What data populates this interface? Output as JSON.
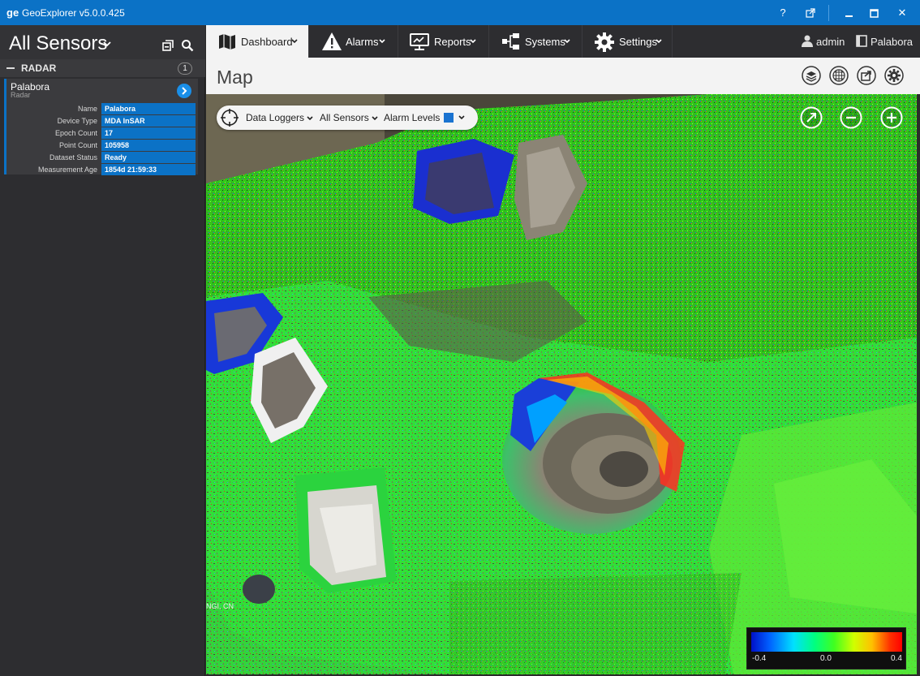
{
  "titlebar": {
    "logo": "ge",
    "title": "GeoExplorer v5.0.0.425",
    "help": "?",
    "popout_icon": "popout-icon",
    "minimize_icon": "minimize-icon",
    "maximize_icon": "maximize-icon",
    "close": "✕"
  },
  "sidebar": {
    "title": "All Sensors",
    "group": {
      "label": "RADAR",
      "count": "1"
    },
    "sensor": {
      "name": "Palabora",
      "type": "Radar",
      "details": [
        {
          "key": "Name",
          "value": "Palabora"
        },
        {
          "key": "Device Type",
          "value": "MDA InSAR"
        },
        {
          "key": "Epoch Count",
          "value": "17"
        },
        {
          "key": "Point Count",
          "value": "105958"
        },
        {
          "key": "Dataset Status",
          "value": "Ready"
        },
        {
          "key": "Measurement Age",
          "value": "1854d 21:59:33"
        }
      ]
    }
  },
  "nav": {
    "items": [
      {
        "label": "Dashboard",
        "icon": "map-icon"
      },
      {
        "label": "Alarms",
        "icon": "warning-icon"
      },
      {
        "label": "Reports",
        "icon": "reports-icon"
      },
      {
        "label": "Systems",
        "icon": "systems-icon"
      },
      {
        "label": "Settings",
        "icon": "gear-icon"
      }
    ],
    "user": "admin",
    "site": "Palabora"
  },
  "page": {
    "title": "Map"
  },
  "map": {
    "toolbar": {
      "data_loggers": "Data Loggers",
      "sensors": "All Sensors",
      "alarm_levels": "Alarm Levels",
      "alarm_color": "#1a73d0"
    },
    "attribution": "NGI, CN",
    "legend": {
      "min": "-0.4",
      "mid": "0.0",
      "max": "0.4"
    }
  }
}
